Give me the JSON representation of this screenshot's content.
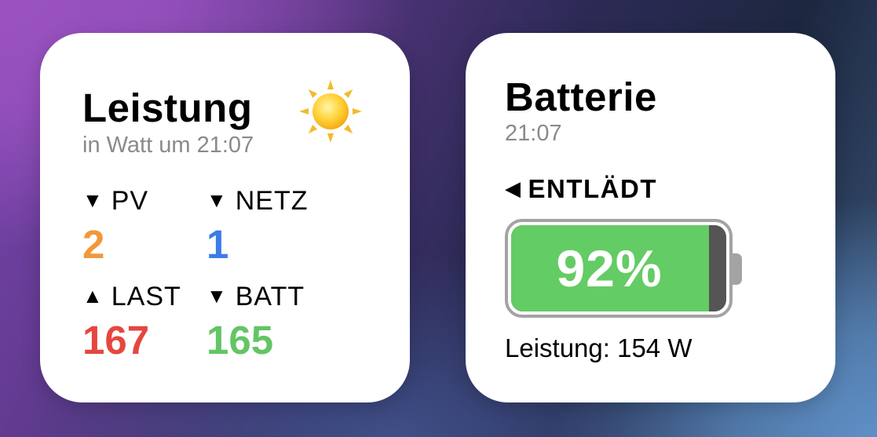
{
  "leistung_widget": {
    "title": "Leistung",
    "subtitle": "in Watt um 21:07",
    "weather_icon": "sun-icon",
    "metrics": [
      {
        "label": "PV",
        "direction": "down",
        "arrow": "▼",
        "value": "2",
        "color": "#f0993a"
      },
      {
        "label": "NETZ",
        "direction": "down",
        "arrow": "▼",
        "value": "1",
        "color": "#3a7de8"
      },
      {
        "label": "LAST",
        "direction": "up",
        "arrow": "▲",
        "value": "167",
        "color": "#e5473e"
      },
      {
        "label": "BATT",
        "direction": "down",
        "arrow": "▼",
        "value": "165",
        "color": "#63c564"
      }
    ]
  },
  "batterie_widget": {
    "title": "Batterie",
    "time": "21:07",
    "status_arrow": "◀",
    "status_label": "ENTLÄDT",
    "charge_text": "92%",
    "charge_level": 0.92,
    "fill_color": "#64cc64",
    "power_text": "Leistung: 154 W"
  }
}
